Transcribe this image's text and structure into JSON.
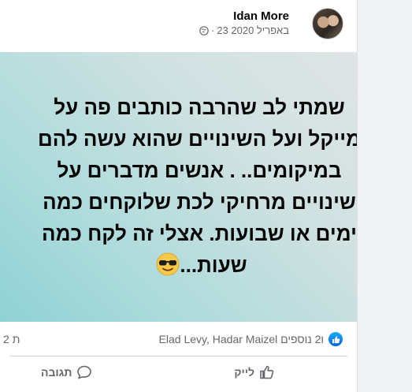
{
  "post": {
    "author": "Idan More",
    "date": "23 באפריל 2020",
    "lines": [
      "שמתי לב שהרבה כותבים פה על",
      "מייקל ועל השינויים שהוא עשה להם",
      "במיקומים.. . אנשים מדברים על",
      "שינויים מרחיקי לכת שלוקחים כמה",
      "ימים או שבועות. אצלי זה לקח כמה",
      "שעות..."
    ],
    "background": "#a9dadb"
  },
  "reactions": {
    "names": "Elad Levy, Hadar Maizel ו2 נוספים",
    "comments": "2 ת"
  },
  "actions": {
    "like": "לייק",
    "comment": "תגובה"
  },
  "icons": [
    "globe-icon",
    "like-reaction-icon",
    "thumbs-up-icon",
    "comment-icon",
    "sunglasses-emoji"
  ]
}
